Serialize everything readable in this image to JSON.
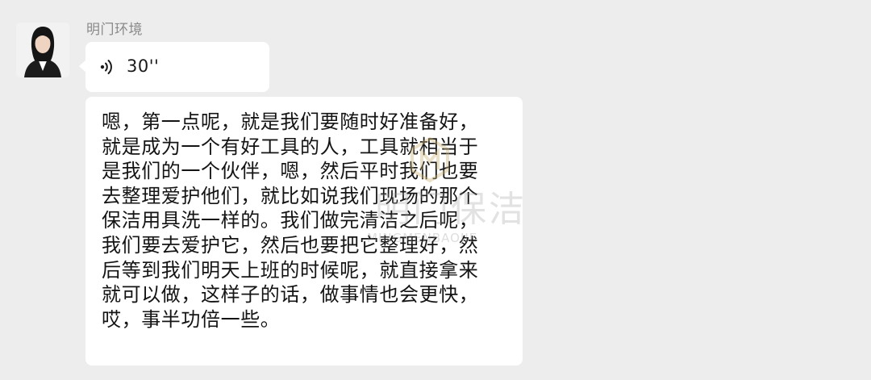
{
  "contact": {
    "name": "明门环境"
  },
  "voice_message": {
    "icon": "voice-wave-icon",
    "duration": "30''"
  },
  "text_message": {
    "content": "嗯，第一点呢，就是我们要随时好准备好，\n就是成为一个有好工具的人，工具就相当于\n是我们的一个伙伴，嗯，然后平时我们也要\n去整理爱护他们，就比如说我们现场的那个\n保洁用具洗一样的。我们做完清洁之后呢，\n我们要去爱护它，然后也要把它整理好，然\n后等到我们明天上班的时候呢，就直接拿来\n就可以做，这样子的话，做事情也会更快，\n哎，事半功倍一些。"
  },
  "watermark": {
    "text_cn": "明门保洁",
    "text_en": "MINGMENBAOJIE"
  },
  "colors": {
    "background": "#ededed",
    "bubble": "#ffffff",
    "name_text": "#8a8a8a",
    "message_text": "#141414"
  }
}
